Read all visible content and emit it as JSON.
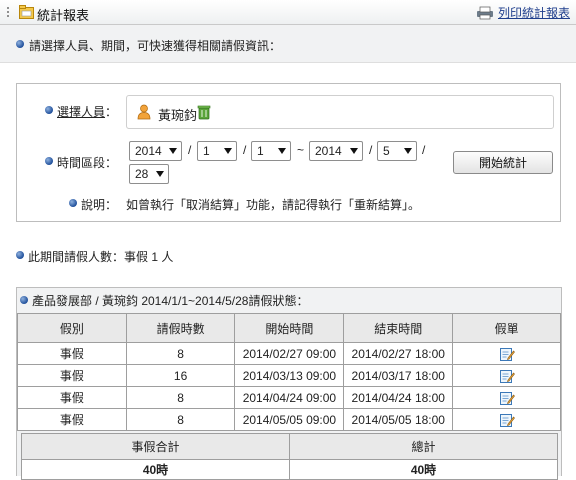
{
  "header": {
    "title": "統計報表",
    "print_label": "列印統計報表"
  },
  "instruction": "請選擇人員、期間，可快速獲得相關請假資訊：",
  "form": {
    "person_label": "選擇人員",
    "person_colon": "：",
    "person_name": "黃琬鈞",
    "period_label": "時間區段：",
    "start": {
      "year": "2014",
      "month": "1",
      "day": "1"
    },
    "end": {
      "year": "2014",
      "month": "5",
      "day": "28"
    },
    "date_sep": "/",
    "range_sep": "~",
    "start_button": "開始統計",
    "note_label": "說明：",
    "note_text": "如曾執行「取消結算」功能，請記得執行「重新結算」。"
  },
  "summary": "此期間請假人數：事假 1 人",
  "detail": {
    "title": "產品發展部 / 黃琬鈞 2014/1/1~2014/5/28請假狀態：",
    "columns": [
      "假別",
      "請假時數",
      "開始時間",
      "結束時間",
      "假單"
    ],
    "rows": [
      {
        "type": "事假",
        "hours": "8",
        "start": "2014/02/27 09:00",
        "end": "2014/02/27 18:00"
      },
      {
        "type": "事假",
        "hours": "16",
        "start": "2014/03/13 09:00",
        "end": "2014/03/17 18:00"
      },
      {
        "type": "事假",
        "hours": "8",
        "start": "2014/04/24 09:00",
        "end": "2014/04/24 18:00"
      },
      {
        "type": "事假",
        "hours": "8",
        "start": "2014/05/05 09:00",
        "end": "2014/05/05 18:00"
      }
    ],
    "totals": {
      "headers": [
        "事假合計",
        "總計"
      ],
      "values": [
        "40時",
        "40時"
      ]
    }
  }
}
